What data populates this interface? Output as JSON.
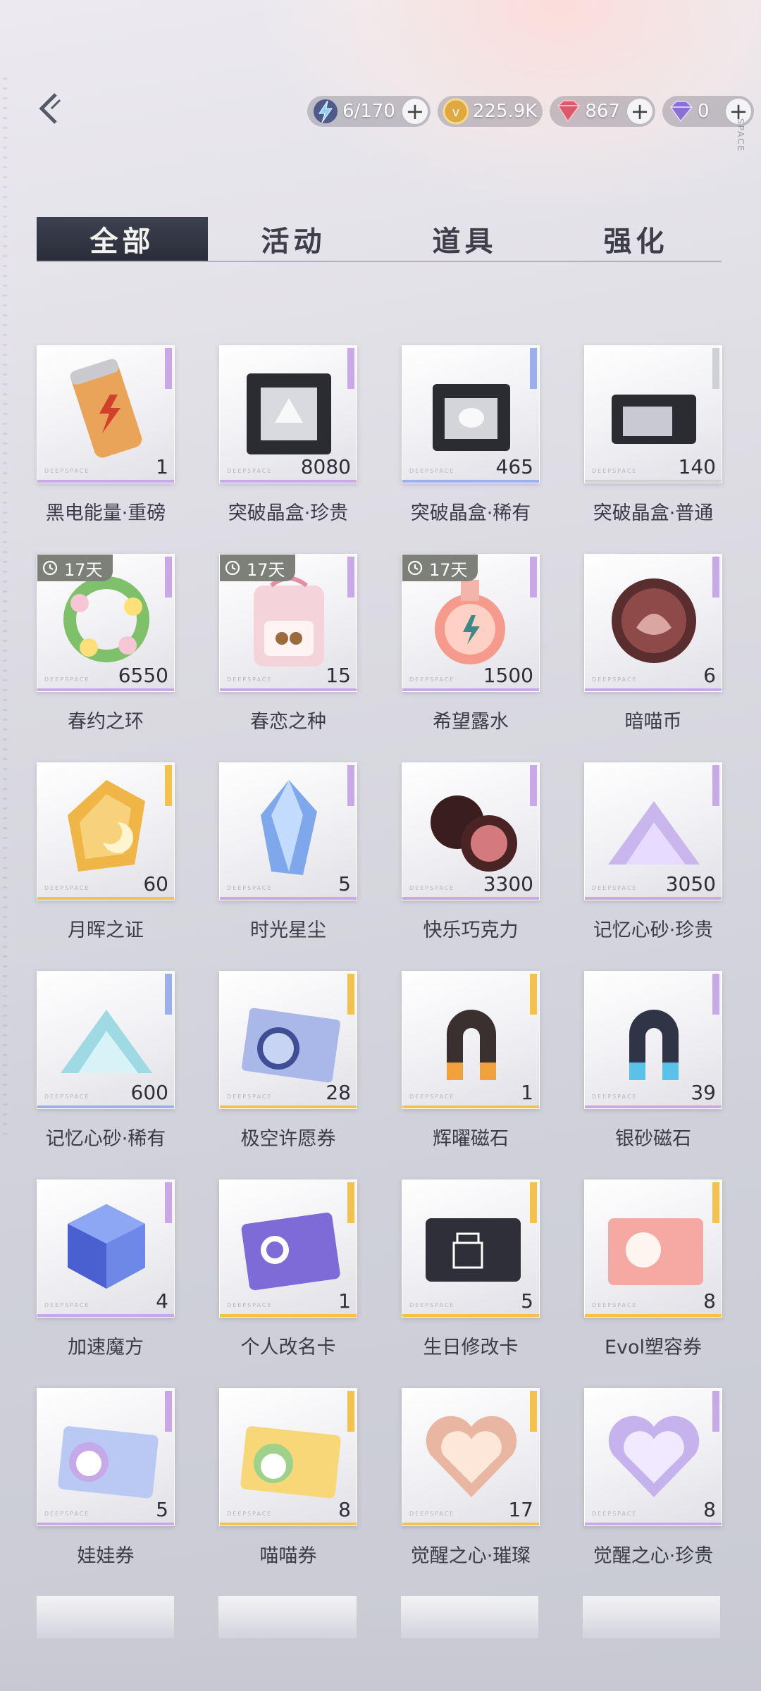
{
  "currencies": [
    {
      "icon": "stamina-bolt-icon",
      "value": "6/170",
      "plus": "+"
    },
    {
      "icon": "gold-coin-icon",
      "value": "225.9K",
      "plus": ""
    },
    {
      "icon": "red-diamond-icon",
      "value": "867",
      "plus": "+"
    },
    {
      "icon": "purple-diamond-icon",
      "value": "0",
      "plus": "+"
    }
  ],
  "corner_label": "SPACE",
  "tabs": [
    {
      "label": "全部",
      "active": true
    },
    {
      "label": "活动",
      "active": false
    },
    {
      "label": "道具",
      "active": false
    },
    {
      "label": "强化",
      "active": false
    }
  ],
  "brand_text": "DEEPSPACE",
  "items": [
    {
      "name": "黑电能量·重磅",
      "qty": "1",
      "art": "energy-can",
      "rarity": "#c9a8e8",
      "timer": ""
    },
    {
      "name": "突破晶盒·珍贵",
      "qty": "8080",
      "art": "crystal-box-large",
      "rarity": "#c9a8e8",
      "timer": ""
    },
    {
      "name": "突破晶盒·稀有",
      "qty": "465",
      "art": "crystal-box-medium",
      "rarity": "#9bb0e8",
      "timer": ""
    },
    {
      "name": "突破晶盒·普通",
      "qty": "140",
      "art": "crystal-box-small",
      "rarity": "#cfcfd6",
      "timer": ""
    },
    {
      "name": "春约之环",
      "qty": "6550",
      "art": "flower-wreath",
      "rarity": "#c9a8e8",
      "timer": "17天"
    },
    {
      "name": "春恋之种",
      "qty": "15",
      "art": "seed-pouch",
      "rarity": "#c9a8e8",
      "timer": "17天"
    },
    {
      "name": "希望露水",
      "qty": "1500",
      "art": "dew-bottle",
      "rarity": "#c9a8e8",
      "timer": "17天"
    },
    {
      "name": "暗喵币",
      "qty": "6",
      "art": "cat-coin",
      "rarity": "#c9a8e8",
      "timer": ""
    },
    {
      "name": "月晖之证",
      "qty": "60",
      "art": "moon-badge",
      "rarity": "#f2c14e",
      "timer": ""
    },
    {
      "name": "时光星尘",
      "qty": "5",
      "art": "blue-crystal",
      "rarity": "#c9a8e8",
      "timer": ""
    },
    {
      "name": "快乐巧克力",
      "qty": "3300",
      "art": "chocolate",
      "rarity": "#c9a8e8",
      "timer": ""
    },
    {
      "name": "记忆心砂·珍贵",
      "qty": "3050",
      "art": "purple-sand",
      "rarity": "#c9a8e8",
      "timer": ""
    },
    {
      "name": "记忆心砂·稀有",
      "qty": "600",
      "art": "blue-sand",
      "rarity": "#9bb0e8",
      "timer": ""
    },
    {
      "name": "极空许愿券",
      "qty": "28",
      "art": "wish-ticket",
      "rarity": "#f2c14e",
      "timer": ""
    },
    {
      "name": "辉曜磁石",
      "qty": "1",
      "art": "gold-magnet",
      "rarity": "#f2c14e",
      "timer": ""
    },
    {
      "name": "银砂磁石",
      "qty": "39",
      "art": "blue-magnet",
      "rarity": "#c9a8e8",
      "timer": ""
    },
    {
      "name": "加速魔方",
      "qty": "4",
      "art": "cube",
      "rarity": "#c9a8e8",
      "timer": ""
    },
    {
      "name": "个人改名卡",
      "qty": "1",
      "art": "rename-card",
      "rarity": "#f2c14e",
      "timer": ""
    },
    {
      "name": "生日修改卡",
      "qty": "5",
      "art": "birthday-card",
      "rarity": "#f2c14e",
      "timer": ""
    },
    {
      "name": "Evol塑容券",
      "qty": "8",
      "art": "evol-ticket",
      "rarity": "#f2c14e",
      "timer": ""
    },
    {
      "name": "娃娃券",
      "qty": "5",
      "art": "doll-ticket",
      "rarity": "#c9a8e8",
      "timer": ""
    },
    {
      "name": "喵喵券",
      "qty": "8",
      "art": "cat-ticket",
      "rarity": "#f2c14e",
      "timer": ""
    },
    {
      "name": "觉醒之心·璀璨",
      "qty": "17",
      "art": "heart-gold",
      "rarity": "#f2c14e",
      "timer": ""
    },
    {
      "name": "觉醒之心·珍贵",
      "qty": "8",
      "art": "heart-purple",
      "rarity": "#c9a8e8",
      "timer": ""
    }
  ]
}
